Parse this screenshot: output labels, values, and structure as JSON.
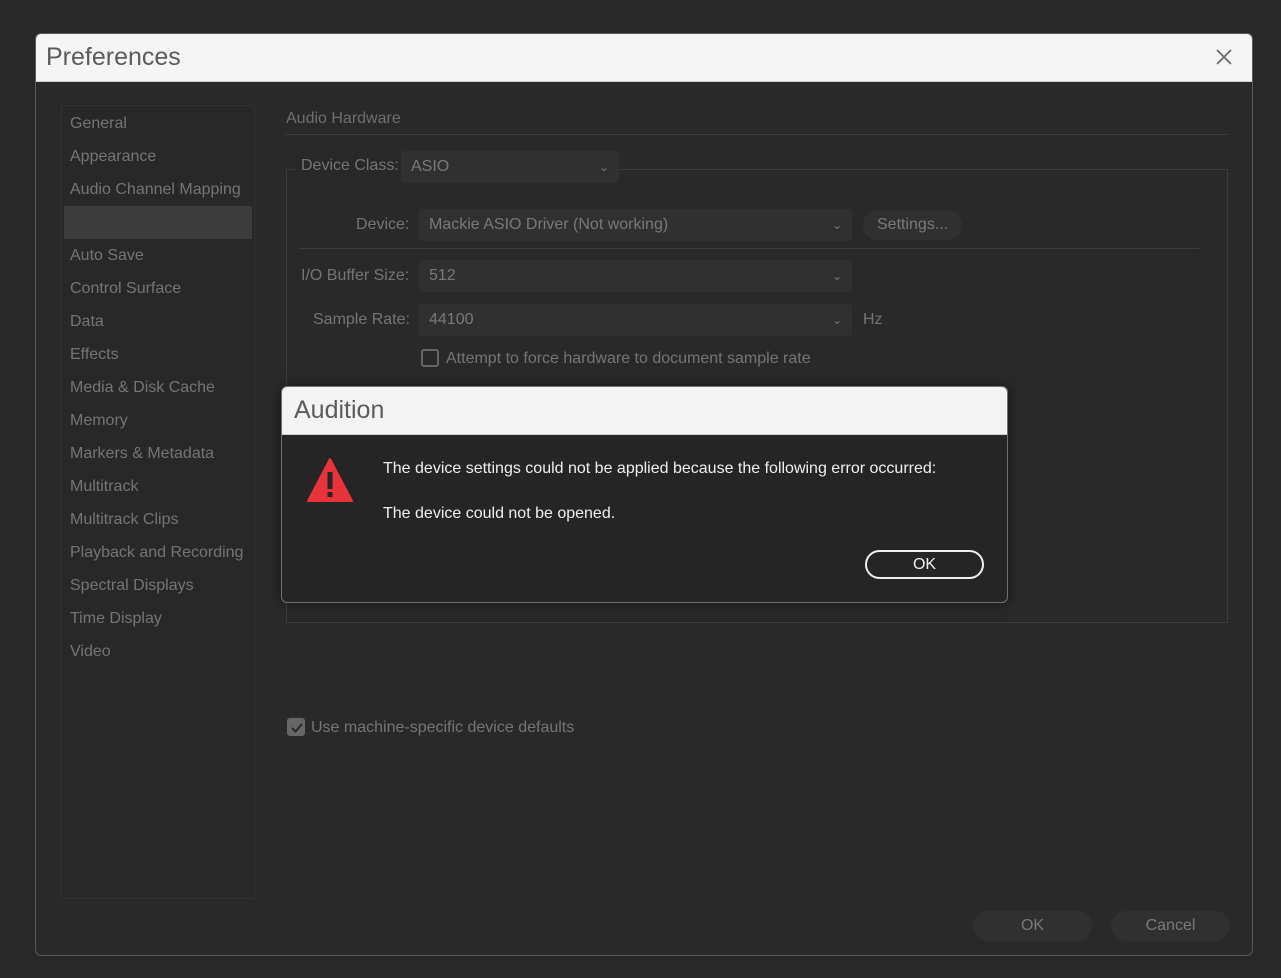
{
  "preferences": {
    "title": "Preferences",
    "categories": [
      "General",
      "Appearance",
      "Audio Channel Mapping",
      "",
      "Auto Save",
      "Control Surface",
      "Data",
      "Effects",
      "Media & Disk Cache",
      "Memory",
      "Markers & Metadata",
      "Multitrack",
      "Multitrack Clips",
      "Playback and Recording",
      "Spectral Displays",
      "Time Display",
      "Video"
    ],
    "selected_index": 3,
    "section_title": "Audio Hardware",
    "device_class_label": "Device Class:",
    "device_class_value": "ASIO",
    "device_label": "Device:",
    "device_value": "Mackie ASIO Driver (Not working)",
    "settings_button": "Settings...",
    "buffer_label": "I/O Buffer Size:",
    "buffer_value": "512",
    "sample_rate_label": "Sample Rate:",
    "sample_rate_value": "44100",
    "sample_rate_unit": "Hz",
    "force_rate_label": "Attempt to force hardware to document sample rate",
    "force_rate_checked": false,
    "machine_defaults_label": "Use machine-specific device defaults",
    "machine_defaults_checked": true,
    "ok_button": "OK",
    "cancel_button": "Cancel"
  },
  "alert": {
    "title": "Audition",
    "message_line1": "The device settings could not be applied because the following error occurred:",
    "message_line2": "The device could not be opened.",
    "ok_button": "OK",
    "icon": "warning-icon",
    "icon_color": "#e8333a"
  }
}
